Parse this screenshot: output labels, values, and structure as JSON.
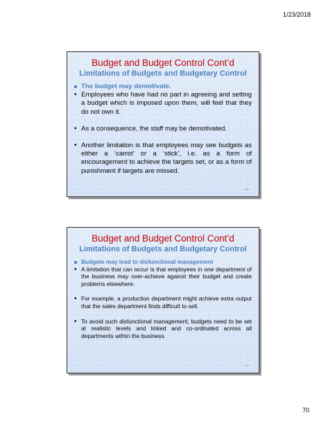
{
  "page": {
    "date": "1/23/2018",
    "number": "70"
  },
  "slides": [
    {
      "title": "Budget and Budget Control Cont’d",
      "subtitle": "Limitations of Budgets and Budgetary Control",
      "heading": "The budget may demotivate.",
      "bullets": [
        "Employees who have had no part in agreeing and setting a budget which is imposed upon them, will feel that they do not own it.",
        "As a consequence, the staff may be demotivated.",
        "Another limitation is that employees may see budgets as either a ‘carrot’ or a ‘stick’, i.e. as a form of encouragement to achieve the targets set, or as a form of punishment if targets are missed."
      ],
      "slide_number": "139"
    },
    {
      "title": "Budget and Budget Control Cont’d",
      "subtitle": "Limitations of Budgets and Budgetary Control",
      "heading": "Budgets may lead to disfunctional management",
      "bullets": [
        "A limitation that can occur is that employees in one department of the business may over-achieve against their budget and create problems elsewhere.",
        "For example, a production department might achieve extra output that the sales department finds difficult to sell.",
        "To avoid such disfunctional management, budgets need to be set at realistic levels and linked and co-ordinated across all departments within the business."
      ],
      "slide_number": "140"
    }
  ]
}
